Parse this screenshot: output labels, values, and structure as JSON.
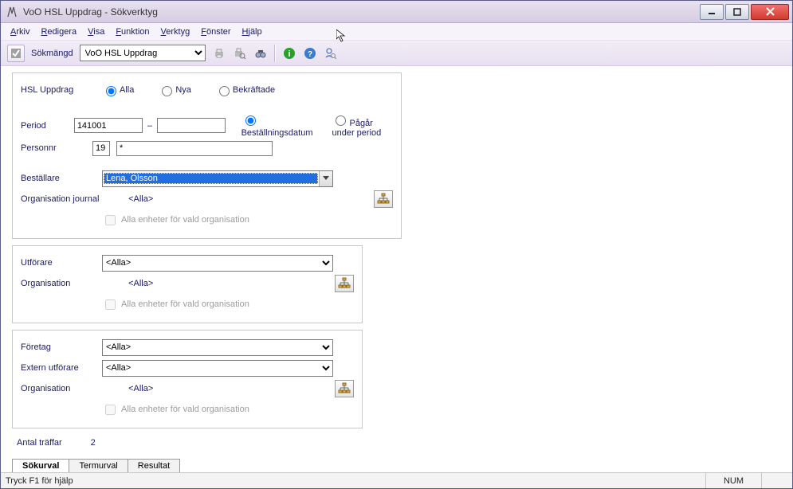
{
  "window": {
    "title": "VoO HSL Uppdrag - Sökverktyg"
  },
  "menu": {
    "arkiv": "Arkiv",
    "redigera": "Redigera",
    "visa": "Visa",
    "funktion": "Funktion",
    "verktyg": "Verktyg",
    "fonster": "Fönster",
    "hjalp": "Hjälp"
  },
  "toolbar": {
    "sokmangd_label": "Sökmängd",
    "sokmangd_value": "VoO HSL Uppdrag"
  },
  "panel1": {
    "hsl_uppdrag_label": "HSL Uppdrag",
    "opt_alla": "Alla",
    "opt_nya": "Nya",
    "opt_bekraftade": "Bekräftade",
    "period_label": "Period",
    "period_from": "141001",
    "period_dash": "–",
    "period_to": "",
    "bestallningsdatum": "Beställningsdatum",
    "pagar": "Pågår under period",
    "personnr_label": "Personnr",
    "personnr_century": "19",
    "personnr_val": "*",
    "bestallare_label": "Beställare",
    "bestallare_value": "Lena, Olsson",
    "org_journal_label": "Organisation journal",
    "alla_link": "<Alla>",
    "alla_enheter": "Alla enheter för vald organisation"
  },
  "panel2": {
    "utforare_label": "Utförare",
    "utforare_value": "<Alla>",
    "org_label": "Organisation",
    "alla_link": "<Alla>",
    "alla_enheter": "Alla enheter för vald organisation"
  },
  "panel3": {
    "foretag_label": "Företag",
    "foretag_value": "<Alla>",
    "extern_label": "Extern utförare",
    "extern_value": "<Alla>",
    "org_label": "Organisation",
    "alla_link": "<Alla>",
    "alla_enheter": "Alla enheter för vald organisation"
  },
  "footer": {
    "antal_label": "Antal träffar",
    "antal_value": "2"
  },
  "tabs": {
    "sokurval": "Sökurval",
    "termurval": "Termurval",
    "resultat": "Resultat"
  },
  "status": {
    "help": "Tryck F1 för hjälp",
    "num": "NUM"
  }
}
